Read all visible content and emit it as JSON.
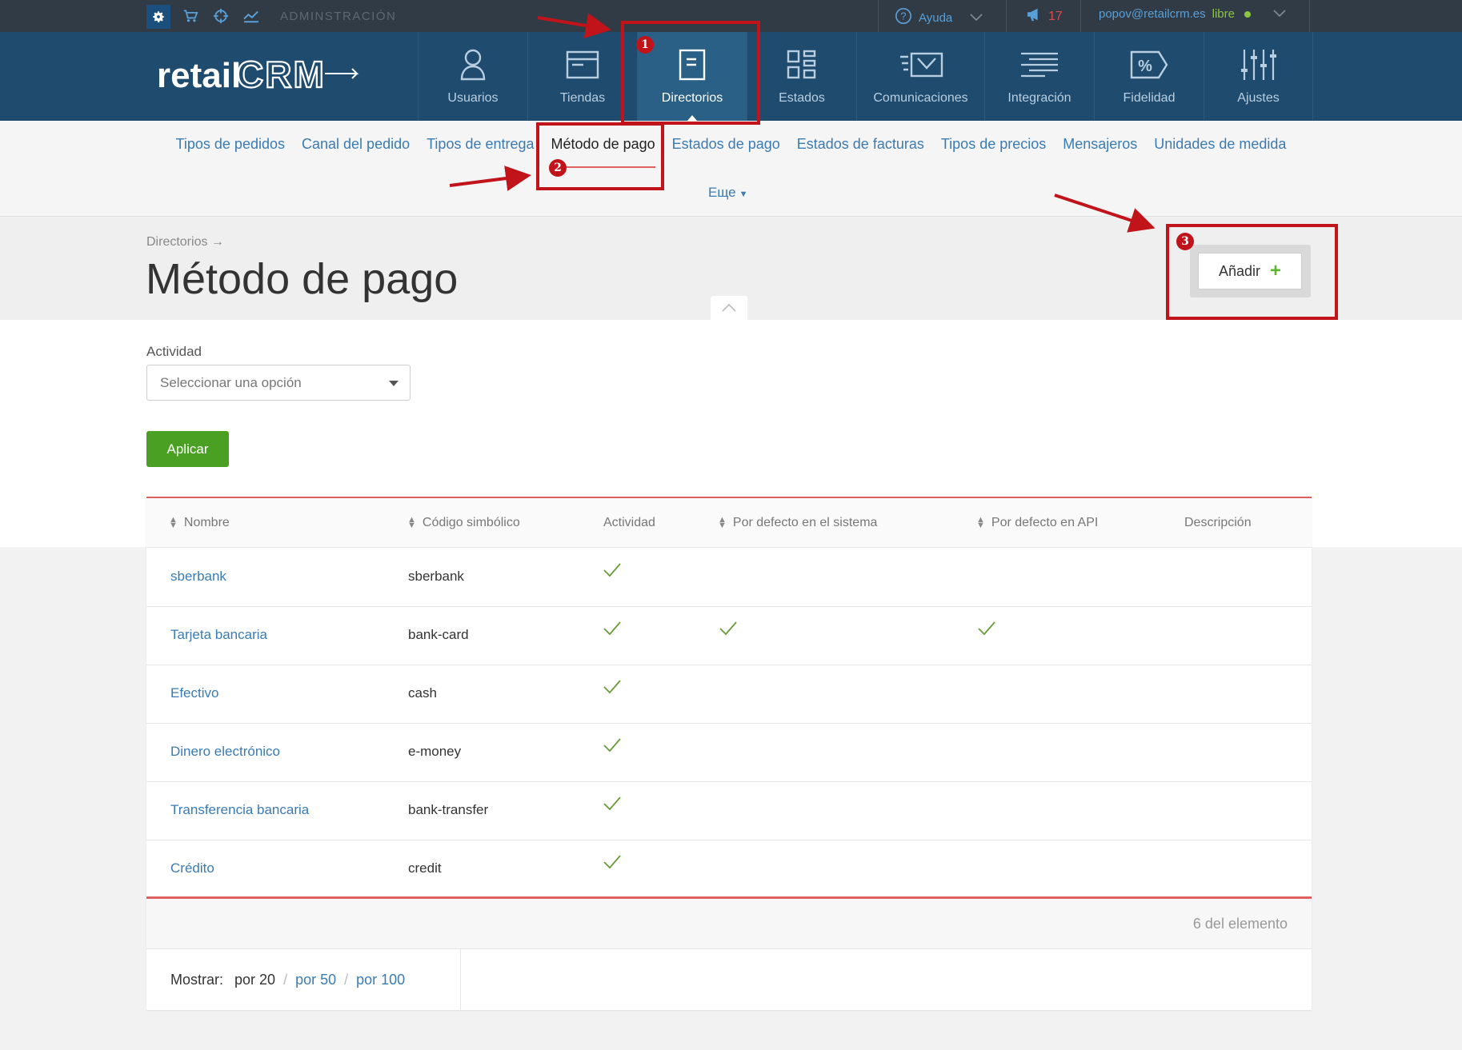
{
  "topbar": {
    "admin_label": "ADMINSTRACIÓN",
    "help_label": "Ayuda",
    "notifications_count": "17",
    "user_email": "popov@retailcrm.es",
    "user_status": "libre"
  },
  "header": {
    "logo_text": "retailCRM",
    "nav": [
      {
        "label": "Usuarios",
        "icon": "user-icon"
      },
      {
        "label": "Tiendas",
        "icon": "store-window-icon"
      },
      {
        "label": "Directorios",
        "icon": "document-icon"
      },
      {
        "label": "Estados",
        "icon": "grid-icon"
      },
      {
        "label": "Comunicaciones",
        "icon": "envelope-icon"
      },
      {
        "label": "Integración",
        "icon": "lines-icon"
      },
      {
        "label": "Fidelidad",
        "icon": "percent-tag-icon"
      },
      {
        "label": "Ajustes",
        "icon": "sliders-icon"
      }
    ]
  },
  "subnav": {
    "items": [
      "Tipos de pedidos",
      "Canal del pedido",
      "Tipos de entrega",
      "Método de pago",
      "Estados de pago",
      "Estados de facturas",
      "Tipos de precios",
      "Mensajeros",
      "Unidades de medida"
    ],
    "more_label": "Еще"
  },
  "page": {
    "breadcrumb": "Directorios →",
    "title": "Método de pago",
    "add_label": "Añadir"
  },
  "filter": {
    "activity_label": "Actividad",
    "activity_placeholder": "Seleccionar una opción",
    "apply_label": "Aplicar"
  },
  "table": {
    "columns": [
      "Nombre",
      "Código simbólico",
      "Actividad",
      "Por defecto en el sistema",
      "Por defecto en API",
      "Descripción"
    ],
    "rows": [
      {
        "name": "sberbank",
        "code": "sberbank",
        "active": true,
        "default_system": false,
        "default_api": false,
        "description": ""
      },
      {
        "name": "Tarjeta bancaria",
        "code": "bank-card",
        "active": true,
        "default_system": true,
        "default_api": true,
        "description": ""
      },
      {
        "name": "Efectivo",
        "code": "cash",
        "active": true,
        "default_system": false,
        "default_api": false,
        "description": ""
      },
      {
        "name": "Dinero electrónico",
        "code": "e-money",
        "active": true,
        "default_system": false,
        "default_api": false,
        "description": ""
      },
      {
        "name": "Transferencia bancaria",
        "code": "bank-transfer",
        "active": true,
        "default_system": false,
        "default_api": false,
        "description": ""
      },
      {
        "name": "Crédito",
        "code": "credit",
        "active": true,
        "default_system": false,
        "default_api": false,
        "description": ""
      }
    ],
    "count_text": "6 del elemento",
    "pager": {
      "label": "Mostrar:",
      "current": "por 20",
      "options": [
        "por 50",
        "por 100"
      ],
      "separator": "/"
    }
  },
  "annotations": [
    "1",
    "2",
    "3"
  ],
  "colors": {
    "header": "#1e4b6e",
    "topbar": "#303b45",
    "link": "#3a7bb3",
    "apply": "#4aa023",
    "annotation": "#c0141a",
    "accent_line": "#e06060"
  }
}
